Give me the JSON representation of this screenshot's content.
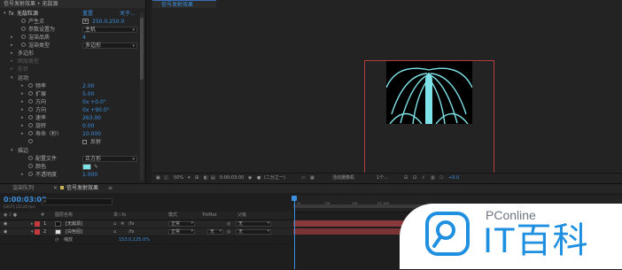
{
  "effect_controls": {
    "header": "信号发射效果 • 无敌源",
    "effect_name": "无敌粒源",
    "reset_label": "重置",
    "about_label": "关于...",
    "rows": [
      {
        "label": "产生点",
        "value": "250.0,250.0"
      },
      {
        "label": "参数设置为",
        "value": "主机"
      },
      {
        "label": "渲染品质",
        "value": "4"
      },
      {
        "label": "渲染类型",
        "value": "多边形"
      },
      {
        "label": "多边形",
        "value": ""
      },
      {
        "label": "图层类型",
        "value": ""
      },
      {
        "label": "形状",
        "value": ""
      },
      {
        "label": "运动",
        "value": ""
      },
      {
        "label": "频率",
        "value": "2.00"
      },
      {
        "label": "扩展",
        "value": "5.00"
      },
      {
        "label": "方向",
        "value": "0x +0.0°"
      },
      {
        "label": "方向",
        "value": "0x +90.0°"
      },
      {
        "label": "速率",
        "value": "263.00"
      },
      {
        "label": "旋转",
        "value": "0.00"
      },
      {
        "label": "寿命（秒）",
        "value": "10.000"
      },
      {
        "label": "",
        "value": "反射"
      },
      {
        "label": "描边",
        "value": ""
      },
      {
        "label": "配置文件",
        "value": "正方形"
      },
      {
        "label": "颜色",
        "value": ""
      },
      {
        "label": "不透明度",
        "value": "1.000"
      }
    ]
  },
  "viewer": {
    "tab_label": "信号发射效果",
    "zoom": "50%",
    "timecode": "0:00:03:00",
    "resolution": "(二分之一)",
    "camera": "活动摄像机",
    "views": "1个...",
    "exposure": "+0.0",
    "render_color": "#7ee3e8"
  },
  "timeline": {
    "tabs": [
      "渲染队列",
      "信号发射效果"
    ],
    "current_time": "0:00:03:00",
    "fps_note": "00075 (25.00 fps)",
    "search_placeholder": "",
    "column_headers": {
      "index": "#",
      "source": "图层名称",
      "switches": "单☆fx",
      "mode": "模式",
      "trkmat": "TrkMat",
      "parent": "父级"
    },
    "ruler_ticks": [
      "0f",
      "10f",
      "20f",
      "01:00f"
    ],
    "layers": [
      {
        "num": "1",
        "name": "[无敌源]",
        "mode": "正常",
        "trkmat": "",
        "parent": "无",
        "color": "#c23a3a"
      },
      {
        "num": "2",
        "name": "[白色固]",
        "mode": "正常",
        "trkmat": "无",
        "parent": "无",
        "color": "#c23a3a"
      }
    ],
    "sub_property": {
      "label": "缩放",
      "value": "153.0,125.0%"
    }
  },
  "watermark": {
    "small": "PConline",
    "big": "IT百科"
  }
}
